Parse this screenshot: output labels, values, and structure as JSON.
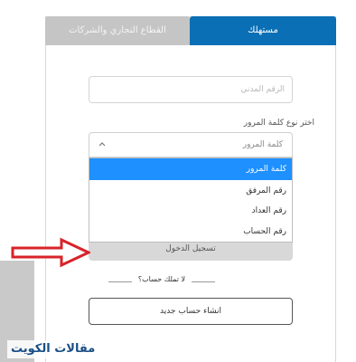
{
  "tabs": {
    "consumer": "مستهلك",
    "business": "القطاع التجاري والشركات"
  },
  "form": {
    "civil_id_placeholder": "الرقم المدني",
    "password_type_label": "اختر نوع كلمة المرور",
    "select_value": "كلمة المرور",
    "options": [
      "كلمة المرور",
      "رقم المرفق",
      "رقم العداد",
      "رقم الحساب"
    ],
    "login_button": "تسجيل الدخول",
    "no_account_text": "لا تملك حساب؟",
    "create_account_button": "انشاء حساب جديد"
  },
  "watermark": "مقالات الكويت",
  "colors": {
    "active_tab": "#0a6fb4",
    "inactive_tab": "#c5c5c5",
    "option_highlight": "#1e90ff",
    "arrow": "#d9232a"
  },
  "icons": {
    "select_toggle": "chevron-up-icon",
    "annotation": "arrow-right-icon"
  }
}
